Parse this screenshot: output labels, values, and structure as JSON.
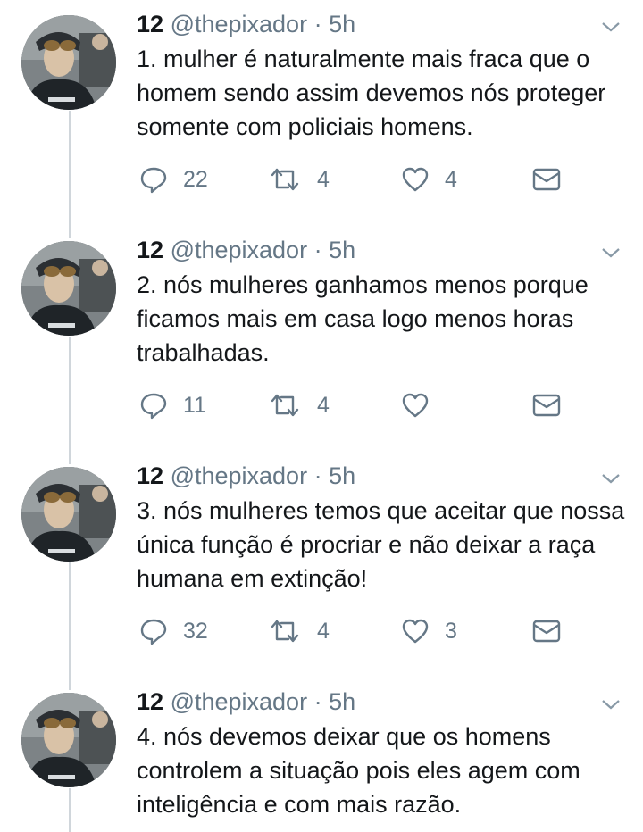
{
  "tweets": [
    {
      "name": "12",
      "handle": "@thepixador",
      "separator": "·",
      "time": "5h",
      "text": "1. mulher é naturalmente mais fraca que o homem sendo assim devemos nós proteger somente com policiais homens.",
      "replies": "22",
      "retweets": "4",
      "likes": "4"
    },
    {
      "name": "12",
      "handle": "@thepixador",
      "separator": "·",
      "time": "5h",
      "text": "2. nós mulheres ganhamos menos porque ficamos mais em casa logo menos horas trabalhadas.",
      "replies": "11",
      "retweets": "4",
      "likes": ""
    },
    {
      "name": "12",
      "handle": "@thepixador",
      "separator": "·",
      "time": "5h",
      "text": "3. nós mulheres temos que aceitar que nossa única função é procriar e não deixar a raça humana em extinção!",
      "replies": "32",
      "retweets": "4",
      "likes": "3"
    },
    {
      "name": "12",
      "handle": "@thepixador",
      "separator": "·",
      "time": "5h",
      "text": "4. nós devemos deixar que os homens controlem a situação pois eles agem com inteligência e com mais razão."
    }
  ],
  "icons": {
    "reply": "reply-icon",
    "retweet": "retweet-icon",
    "like": "heart-icon",
    "dm": "envelope-icon",
    "caret": "chevron-down-icon"
  },
  "colors": {
    "text": "#14171a",
    "muted": "#657786",
    "thread_line": "#d0d6db"
  }
}
